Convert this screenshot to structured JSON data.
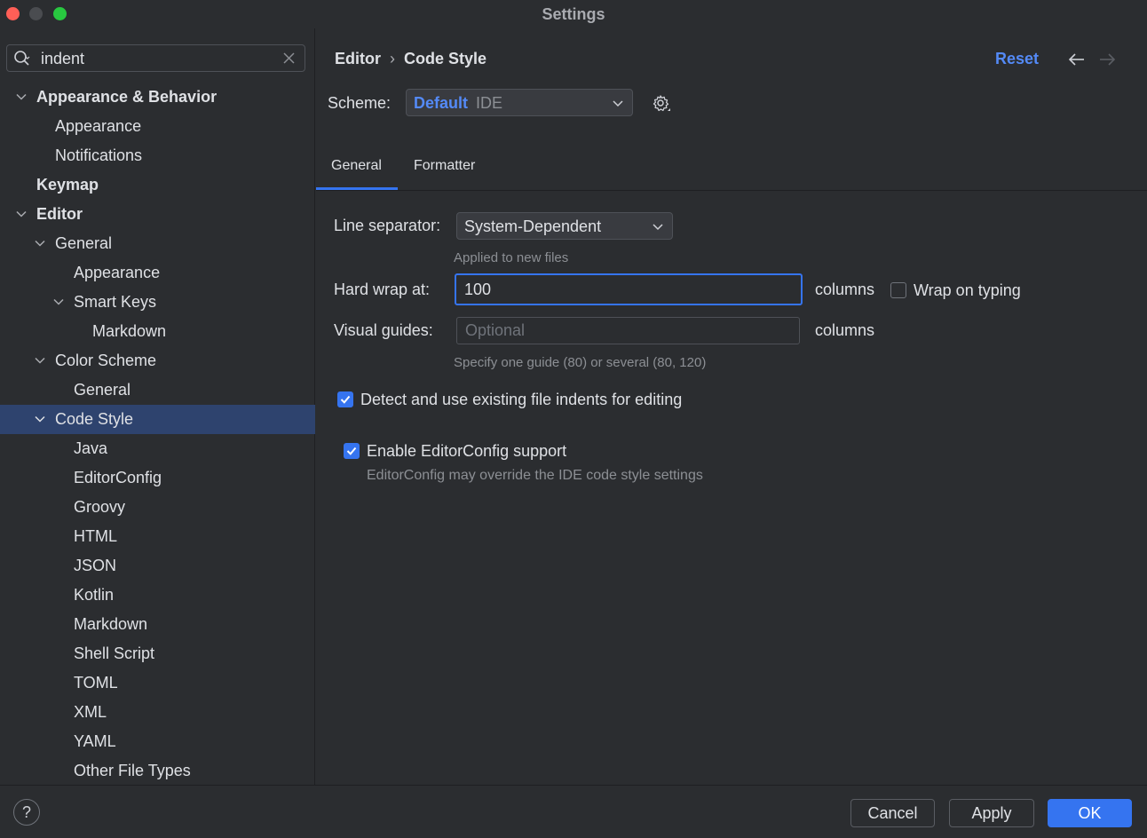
{
  "window": {
    "title": "Settings"
  },
  "colors": {
    "accent": "#3574f0",
    "link": "#548af7",
    "selection": "#2e436e",
    "background": "#2b2d30"
  },
  "search": {
    "value": "indent"
  },
  "tree": [
    {
      "label": "Appearance & Behavior",
      "bold": true,
      "expanded": true
    },
    {
      "label": "Appearance"
    },
    {
      "label": "Notifications"
    },
    {
      "label": "Keymap",
      "bold": true
    },
    {
      "label": "Editor",
      "bold": true,
      "expanded": true
    },
    {
      "label": "General",
      "expanded": true
    },
    {
      "label": "Appearance"
    },
    {
      "label": "Smart Keys",
      "expanded": true
    },
    {
      "label": "Markdown"
    },
    {
      "label": "Color Scheme",
      "expanded": true
    },
    {
      "label": "General"
    },
    {
      "label": "Code Style",
      "expanded": true,
      "selected": true
    },
    {
      "label": "Java"
    },
    {
      "label": "EditorConfig"
    },
    {
      "label": "Groovy"
    },
    {
      "label": "HTML"
    },
    {
      "label": "JSON"
    },
    {
      "label": "Kotlin"
    },
    {
      "label": "Markdown"
    },
    {
      "label": "Shell Script"
    },
    {
      "label": "TOML"
    },
    {
      "label": "XML"
    },
    {
      "label": "YAML"
    },
    {
      "label": "Other File Types"
    }
  ],
  "breadcrumb": {
    "parent": "Editor",
    "separator": "›",
    "current": "Code Style"
  },
  "header": {
    "reset_label": "Reset",
    "back_icon": "arrow-left-icon",
    "forward_icon": "arrow-right-icon"
  },
  "scheme": {
    "label": "Scheme:",
    "name": "Default",
    "kind": "IDE"
  },
  "tabs": [
    {
      "label": "General",
      "active": true
    },
    {
      "label": "Formatter",
      "active": false
    }
  ],
  "general": {
    "line_separator_label": "Line separator:",
    "line_separator_value": "System-Dependent",
    "line_separator_hint": "Applied to new files",
    "hard_wrap_label": "Hard wrap at:",
    "hard_wrap_value": "100",
    "hard_wrap_unit": "columns",
    "wrap_on_typing_label": "Wrap on typing",
    "wrap_on_typing_checked": false,
    "visual_guides_label": "Visual guides:",
    "visual_guides_placeholder": "Optional",
    "visual_guides_unit": "columns",
    "visual_guides_hint": "Specify one guide (80) or several (80, 120)",
    "detect_indents_label": "Detect and use existing file indents for editing",
    "detect_indents_checked": true,
    "editorconfig_label": "Enable EditorConfig support",
    "editorconfig_checked": true,
    "editorconfig_hint": "EditorConfig may override the IDE code style settings"
  },
  "footer": {
    "help_label": "?",
    "cancel_label": "Cancel",
    "apply_label": "Apply",
    "ok_label": "OK"
  }
}
